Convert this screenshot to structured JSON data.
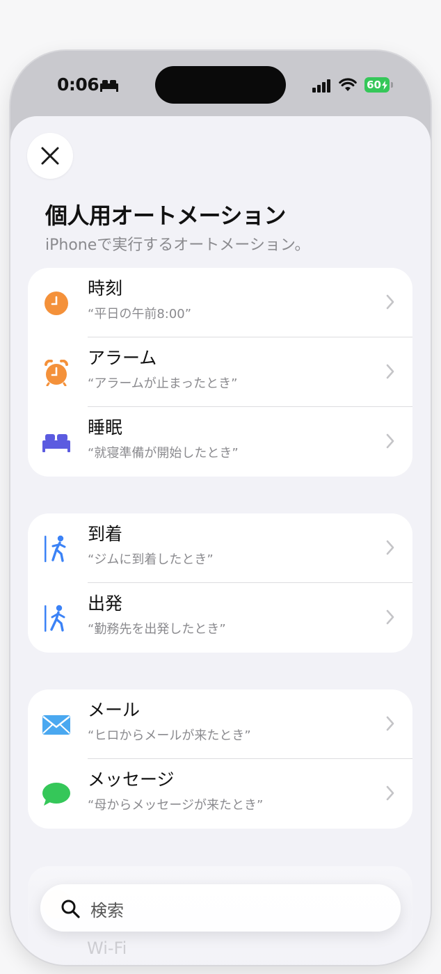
{
  "status_bar": {
    "time": "0:06",
    "battery": "60"
  },
  "sheet": {
    "title": "個人用オートメーション",
    "subtitle": "iPhoneで実行するオートメーション。"
  },
  "groups": [
    {
      "items": [
        {
          "icon": "clock-icon",
          "title": "時刻",
          "subtitle": "“平日の午前8:00”"
        },
        {
          "icon": "alarm-icon",
          "title": "アラーム",
          "subtitle": "“アラームが止まったとき”"
        },
        {
          "icon": "bed-icon",
          "title": "睡眠",
          "subtitle": "“就寝準備が開始したとき”"
        }
      ]
    },
    {
      "items": [
        {
          "icon": "arrive-icon",
          "title": "到着",
          "subtitle": "“ジムに到着したとき”"
        },
        {
          "icon": "leave-icon",
          "title": "出発",
          "subtitle": "“勤務先を出発したとき”"
        }
      ]
    },
    {
      "items": [
        {
          "icon": "mail-icon",
          "title": "メール",
          "subtitle": "“ヒロからメールが来たとき”"
        },
        {
          "icon": "message-icon",
          "title": "メッセージ",
          "subtitle": "“母からメッセージが来たとき”"
        }
      ]
    }
  ],
  "peek": {
    "wifi_label": "Wi-Fi"
  },
  "search": {
    "placeholder": "検索"
  },
  "colors": {
    "orange": "#f4913a",
    "blue": "#3b82f6",
    "purple": "#5b5be0",
    "mail_blue": "#4aa8f0",
    "green": "#35c759",
    "chevron": "#c4c4c7"
  }
}
